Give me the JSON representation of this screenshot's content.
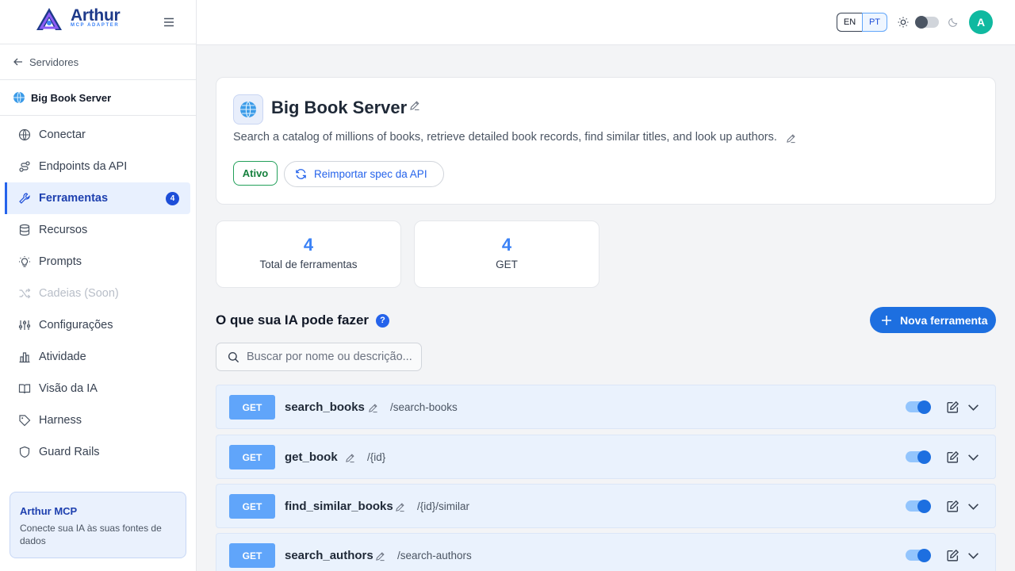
{
  "brand": {
    "name": "Arthur",
    "subtitle": "MCP ADAPTER"
  },
  "sidebar": {
    "back_label": "Servidores",
    "server_name": "Big Book Server",
    "items": [
      {
        "label": "Conectar",
        "icon": "globe-icon"
      },
      {
        "label": "Endpoints da API",
        "icon": "route-icon"
      },
      {
        "label": "Ferramentas",
        "icon": "wrench-icon",
        "badge": "4",
        "active": true
      },
      {
        "label": "Recursos",
        "icon": "database-icon"
      },
      {
        "label": "Prompts",
        "icon": "lightbulb-icon"
      },
      {
        "label": "Cadeias (Soon)",
        "icon": "shuffle-icon",
        "disabled": true
      },
      {
        "label": "Configurações",
        "icon": "sliders-icon"
      },
      {
        "label": "Atividade",
        "icon": "bar-chart-icon"
      },
      {
        "label": "Visão da IA",
        "icon": "book-open-icon"
      },
      {
        "label": "Harness",
        "icon": "tag-icon"
      },
      {
        "label": "Guard Rails",
        "icon": "shield-icon"
      }
    ],
    "promo": {
      "title": "Arthur MCP",
      "text": "Conecte sua IA às suas fontes de dados"
    }
  },
  "topbar": {
    "lang_en": "EN",
    "lang_pt": "PT",
    "avatar_letter": "A"
  },
  "server": {
    "title": "Big Book Server",
    "description": "Search a catalog of millions of books, retrieve detailed book records, find similar titles, and look up authors.",
    "status": "Ativo",
    "reimport_label": "Reimportar spec da API"
  },
  "stats": [
    {
      "value": "4",
      "label": "Total de ferramentas"
    },
    {
      "value": "4",
      "label": "GET"
    }
  ],
  "tools_section": {
    "title": "O que sua IA pode fazer",
    "help": "?",
    "new_button": "Nova ferramenta",
    "search_placeholder": "Buscar por nome ou descrição..."
  },
  "tools": [
    {
      "method": "GET",
      "name": "search_books",
      "path": "/search-books",
      "enabled": true
    },
    {
      "method": "GET",
      "name": "get_book",
      "path": "/{id}",
      "enabled": true
    },
    {
      "method": "GET",
      "name": "find_similar_books",
      "path": "/{id}/similar",
      "enabled": true
    },
    {
      "method": "GET",
      "name": "search_authors",
      "path": "/search-authors",
      "enabled": true
    }
  ],
  "colors": {
    "accent": "#1d6fe0",
    "active_status": "#15803d",
    "avatar": "#10b9a0"
  }
}
